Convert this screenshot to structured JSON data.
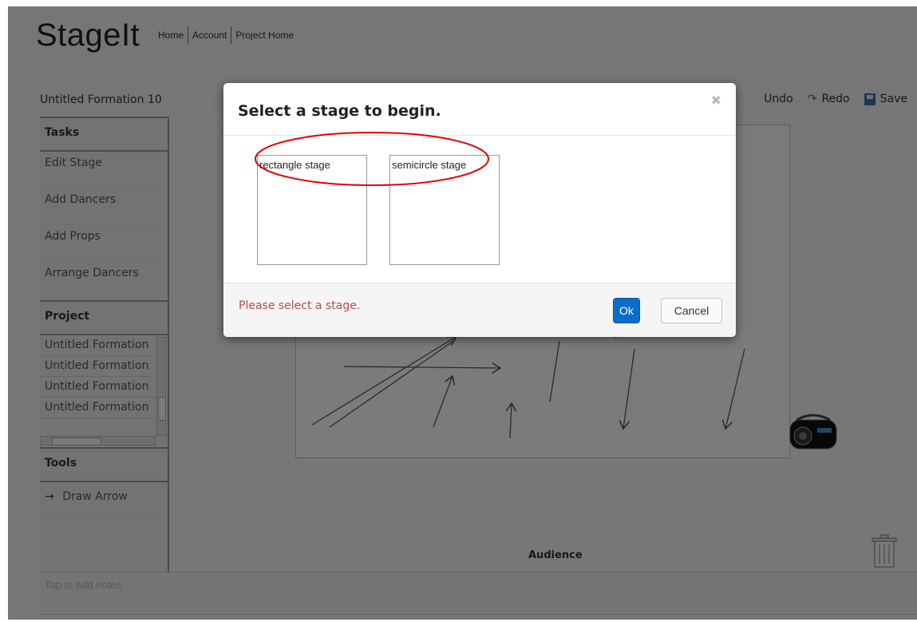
{
  "brand": "StageIt",
  "nav": [
    "Home",
    "Account",
    "Project Home"
  ],
  "formation_title": "Untitled Formation 10",
  "toolbar": {
    "undo_label": "Undo",
    "redo_label": "Redo",
    "save_label": "Save"
  },
  "sidebar": {
    "tasks_heading": "Tasks",
    "tasks": [
      "Edit Stage",
      "Add Dancers",
      "Add Props",
      "Arrange Dancers"
    ],
    "project_heading": "Project",
    "project_items": [
      "Untitled Formation",
      "Untitled Formation",
      "Untitled Formation",
      "Untitled Formation"
    ],
    "tools_heading": "Tools",
    "tools": [
      {
        "icon": "arrow-right-icon",
        "label": "Draw Arrow"
      }
    ]
  },
  "canvas": {
    "audience_label": "Audience"
  },
  "notes": {
    "placeholder": "Tap to add notes"
  },
  "modal": {
    "title": "Select a stage to begin.",
    "options": [
      "rectangle stage",
      "semicircle stage"
    ],
    "error": "Please select a stage.",
    "ok_label": "Ok",
    "cancel_label": "Cancel"
  },
  "colors": {
    "primary_button": "#0a6ec8",
    "error_text": "#b94a48",
    "annotation": "#e00000"
  }
}
